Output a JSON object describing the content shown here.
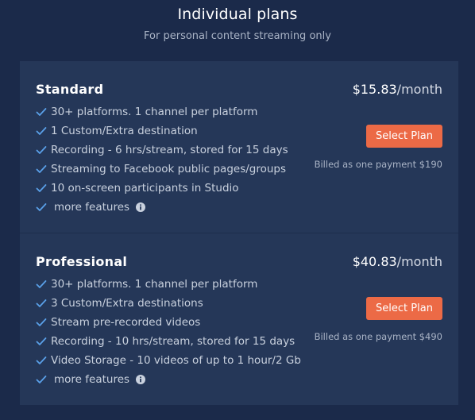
{
  "header": {
    "title": "Individual plans",
    "subtitle": "For personal content streaming only"
  },
  "colors": {
    "background": "#1b2a4a",
    "panel": "#253758",
    "accent": "#ec6a46",
    "check": "#5aa0e8"
  },
  "plans": [
    {
      "name": "Standard",
      "price": "$15.83",
      "period": "/month",
      "button_label": "Select Plan",
      "billed": "Billed as one payment $190",
      "features": [
        "30+ platforms. 1 channel per platform",
        "1 Custom/Extra destination",
        "Recording - 6 hrs/stream, stored for 15 days",
        "Streaming to Facebook public pages/groups",
        "10 on-screen participants in Studio"
      ],
      "more_features": "more features"
    },
    {
      "name": "Professional",
      "price": "$40.83",
      "period": "/month",
      "button_label": "Select Plan",
      "billed": "Billed as one payment $490",
      "features": [
        "30+ platforms. 1 channel per platform",
        "3 Custom/Extra destinations",
        "Stream pre-recorded videos",
        "Recording - 10 hrs/stream, stored for 15 days",
        "Video Storage - 10 videos of up to 1 hour/2 Gb"
      ],
      "more_features": "more features"
    }
  ],
  "icons": {
    "check": "check-icon",
    "info": "info-icon"
  }
}
